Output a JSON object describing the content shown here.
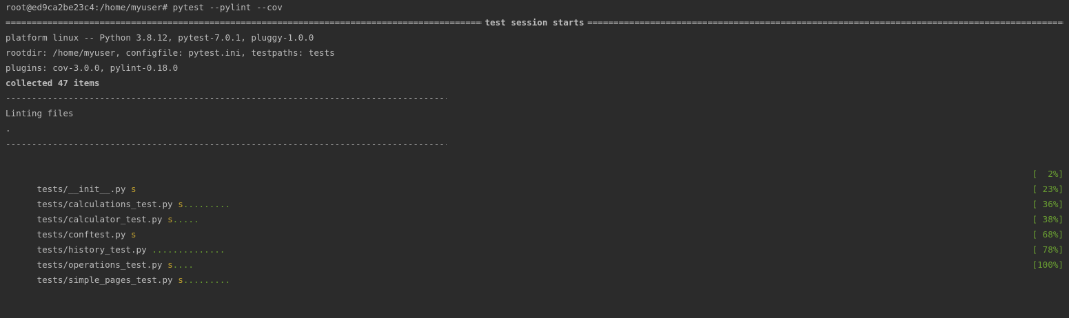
{
  "prompt": {
    "text": "root@ed9ca2be23c4:/home/myuser# pytest --pylint --cov"
  },
  "session_header": {
    "title": "test session starts"
  },
  "info_lines": [
    "platform linux -- Python 3.8.12, pytest-7.0.1, pluggy-1.0.0",
    "rootdir: /home/myuser, configfile: pytest.ini, testpaths: tests",
    "plugins: cov-3.0.0, pylint-0.18.0"
  ],
  "collected": "collected 47 items",
  "linting": {
    "label": "Linting files",
    "dots": "."
  },
  "results": [
    {
      "file": "tests/__init__.py ",
      "skips": "s",
      "passes": "",
      "progress": "[  2%]"
    },
    {
      "file": "tests/calculations_test.py ",
      "skips": "s",
      "passes": ".........",
      "progress": "[ 23%]"
    },
    {
      "file": "tests/calculator_test.py ",
      "skips": "s",
      "passes": ".....",
      "progress": "[ 36%]"
    },
    {
      "file": "tests/conftest.py ",
      "skips": "s",
      "passes": "",
      "progress": "[ 38%]"
    },
    {
      "file": "tests/history_test.py ",
      "skips": "",
      "passes": "..............",
      "progress": "[ 68%]"
    },
    {
      "file": "tests/operations_test.py ",
      "skips": "s",
      "passes": "....",
      "progress": "[ 78%]"
    },
    {
      "file": "tests/simple_pages_test.py ",
      "skips": "s",
      "passes": ".........",
      "progress": "[100%]"
    }
  ],
  "colors": {
    "background": "#2b2b2b",
    "text": "#bbbbbb",
    "pass": "#6a9f32",
    "skip": "#c0a02f"
  }
}
